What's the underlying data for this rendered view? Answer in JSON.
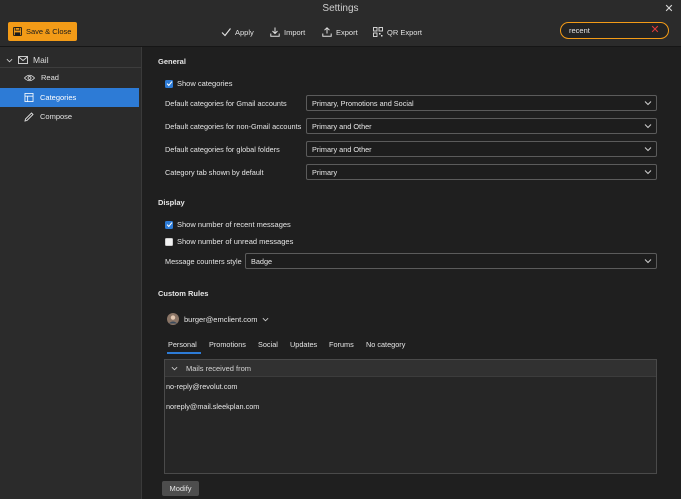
{
  "window": {
    "title": "Settings",
    "close_glyph": "✕"
  },
  "toolbar": {
    "save_label": "Save & Close",
    "apply_label": "Apply",
    "import_label": "Import",
    "export_label": "Export",
    "qr_export_label": "QR Export"
  },
  "search": {
    "value": "recent",
    "placeholder": "",
    "clear_glyph": "✕"
  },
  "sidebar": {
    "group_label": "Mail",
    "items": [
      {
        "label": "Read",
        "icon": "eye-icon",
        "active": false
      },
      {
        "label": "Categories",
        "icon": "categories-icon",
        "active": true
      },
      {
        "label": "Compose",
        "icon": "pencil-icon",
        "active": false
      }
    ]
  },
  "general": {
    "title": "General",
    "show_categories": {
      "label": "Show categories",
      "checked": true
    },
    "rows": [
      {
        "label": "Default categories for Gmail accounts",
        "value": "Primary, Promotions and Social"
      },
      {
        "label": "Default categories for non-Gmail accounts",
        "value": "Primary and Other"
      },
      {
        "label": "Default categories for global folders",
        "value": "Primary and Other"
      },
      {
        "label": "Category tab shown by default",
        "value": "Primary"
      }
    ]
  },
  "display": {
    "title": "Display",
    "show_recent": {
      "label": "Show number of recent messages",
      "checked": true
    },
    "show_unread": {
      "label": "Show number of unread messages",
      "checked": false
    },
    "counters": {
      "label": "Message counters style",
      "value": "Badge"
    }
  },
  "custom_rules": {
    "title": "Custom Rules",
    "account": "burger@emclient.com",
    "tabs": [
      "Personal",
      "Promotions",
      "Social",
      "Updates",
      "Forums",
      "No category"
    ],
    "active_tab": "Personal",
    "group_label": "Mails received from",
    "items": [
      "no-reply@revolut.com",
      "noreply@mail.sleekplan.com"
    ],
    "modify_label": "Modify"
  },
  "colors": {
    "accent": "#f39b17",
    "selection": "#2d7bd6",
    "clear": "#e03b3b"
  }
}
